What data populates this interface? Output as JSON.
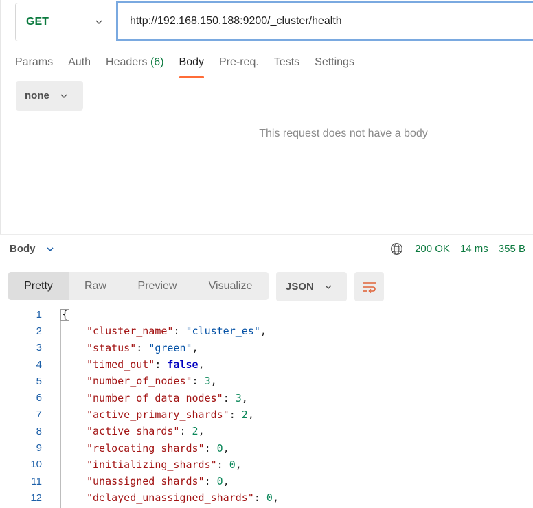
{
  "request": {
    "method": "GET",
    "url": "http://192.168.150.188:9200/_cluster/health"
  },
  "request_tabs": [
    {
      "label": "Params",
      "count": ""
    },
    {
      "label": "Auth",
      "count": ""
    },
    {
      "label": "Headers",
      "count": "(6)"
    },
    {
      "label": "Body",
      "count": ""
    },
    {
      "label": "Pre-req.",
      "count": ""
    },
    {
      "label": "Tests",
      "count": ""
    },
    {
      "label": "Settings",
      "count": ""
    }
  ],
  "active_request_tab": "Body",
  "body_type": "none",
  "empty_body_message": "This request does not have a body",
  "response": {
    "label": "Body",
    "status": "200 OK",
    "time": "14 ms",
    "size": "355 B",
    "view_tabs": [
      "Pretty",
      "Raw",
      "Preview",
      "Visualize"
    ],
    "active_view": "Pretty",
    "format": "JSON"
  },
  "code_lines": [
    {
      "num": "1",
      "tokens": [
        {
          "t": "brace",
          "v": "{"
        }
      ]
    },
    {
      "num": "2",
      "tokens": [
        {
          "t": "k",
          "v": "\"cluster_name\""
        },
        {
          "t": "p",
          "v": ": "
        },
        {
          "t": "s",
          "v": "\"cluster_es\""
        },
        {
          "t": "p",
          "v": ","
        }
      ]
    },
    {
      "num": "3",
      "tokens": [
        {
          "t": "k",
          "v": "\"status\""
        },
        {
          "t": "p",
          "v": ": "
        },
        {
          "t": "s",
          "v": "\"green\""
        },
        {
          "t": "p",
          "v": ","
        }
      ]
    },
    {
      "num": "4",
      "tokens": [
        {
          "t": "k",
          "v": "\"timed_out\""
        },
        {
          "t": "p",
          "v": ": "
        },
        {
          "t": "b",
          "v": "false"
        },
        {
          "t": "p",
          "v": ","
        }
      ]
    },
    {
      "num": "5",
      "tokens": [
        {
          "t": "k",
          "v": "\"number_of_nodes\""
        },
        {
          "t": "p",
          "v": ": "
        },
        {
          "t": "n",
          "v": "3"
        },
        {
          "t": "p",
          "v": ","
        }
      ]
    },
    {
      "num": "6",
      "tokens": [
        {
          "t": "k",
          "v": "\"number_of_data_nodes\""
        },
        {
          "t": "p",
          "v": ": "
        },
        {
          "t": "n",
          "v": "3"
        },
        {
          "t": "p",
          "v": ","
        }
      ]
    },
    {
      "num": "7",
      "tokens": [
        {
          "t": "k",
          "v": "\"active_primary_shards\""
        },
        {
          "t": "p",
          "v": ": "
        },
        {
          "t": "n",
          "v": "2"
        },
        {
          "t": "p",
          "v": ","
        }
      ]
    },
    {
      "num": "8",
      "tokens": [
        {
          "t": "k",
          "v": "\"active_shards\""
        },
        {
          "t": "p",
          "v": ": "
        },
        {
          "t": "n",
          "v": "2"
        },
        {
          "t": "p",
          "v": ","
        }
      ]
    },
    {
      "num": "9",
      "tokens": [
        {
          "t": "k",
          "v": "\"relocating_shards\""
        },
        {
          "t": "p",
          "v": ": "
        },
        {
          "t": "n",
          "v": "0"
        },
        {
          "t": "p",
          "v": ","
        }
      ]
    },
    {
      "num": "10",
      "tokens": [
        {
          "t": "k",
          "v": "\"initializing_shards\""
        },
        {
          "t": "p",
          "v": ": "
        },
        {
          "t": "n",
          "v": "0"
        },
        {
          "t": "p",
          "v": ","
        }
      ]
    },
    {
      "num": "11",
      "tokens": [
        {
          "t": "k",
          "v": "\"unassigned_shards\""
        },
        {
          "t": "p",
          "v": ": "
        },
        {
          "t": "n",
          "v": "0"
        },
        {
          "t": "p",
          "v": ","
        }
      ]
    },
    {
      "num": "12",
      "tokens": [
        {
          "t": "k",
          "v": "\"delayed_unassigned_shards\""
        },
        {
          "t": "p",
          "v": ": "
        },
        {
          "t": "n",
          "v": "0"
        },
        {
          "t": "p",
          "v": ","
        }
      ]
    }
  ],
  "colors": {
    "accent": "#ff6c37",
    "method_get": "#0c7a3f",
    "status_ok": "#0c7a3f",
    "url_focus_border": "#7aa9e0"
  }
}
